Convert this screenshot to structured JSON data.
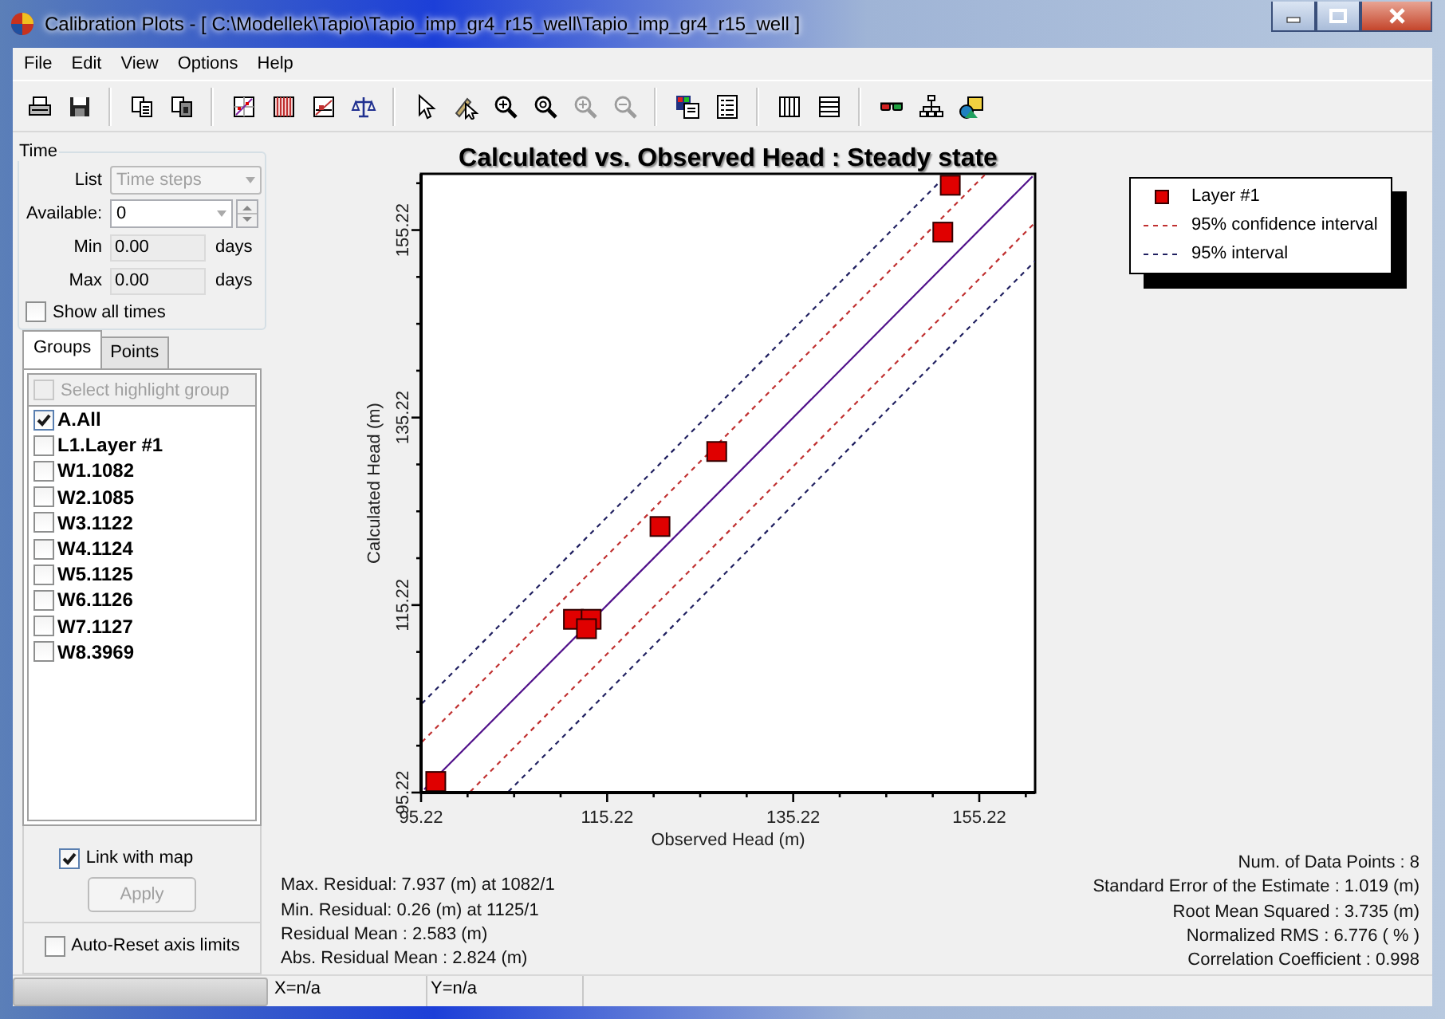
{
  "window": {
    "title": "Calibration Plots -  [ C:\\Modellek\\Tapio\\Tapio_imp_gr4_r15_well\\Tapio_imp_gr4_r15_well ]"
  },
  "menu": [
    "File",
    "Edit",
    "View",
    "Options",
    "Help"
  ],
  "toolbar": {
    "groups": [
      {
        "items": [
          {
            "kind": "print",
            "disabled": false
          },
          {
            "kind": "save",
            "disabled": false
          }
        ]
      },
      {
        "items": [
          {
            "kind": "copy",
            "disabled": false
          },
          {
            "kind": "copy-special",
            "disabled": false
          }
        ]
      },
      {
        "items": [
          {
            "kind": "chart-grid",
            "disabled": false
          },
          {
            "kind": "chart-hatch",
            "disabled": false
          },
          {
            "kind": "chart-fit",
            "disabled": false
          },
          {
            "kind": "balance",
            "disabled": false
          }
        ]
      },
      {
        "items": [
          {
            "kind": "pointer",
            "disabled": false
          },
          {
            "kind": "pointer-edit",
            "disabled": false
          },
          {
            "kind": "zoom-in",
            "disabled": false
          },
          {
            "kind": "zoom",
            "disabled": false
          },
          {
            "kind": "zoom-in",
            "disabled": true
          },
          {
            "kind": "zoom-out",
            "disabled": true
          }
        ]
      },
      {
        "items": [
          {
            "kind": "palette",
            "disabled": false
          },
          {
            "kind": "list",
            "disabled": false
          }
        ]
      },
      {
        "items": [
          {
            "kind": "columns",
            "disabled": false
          },
          {
            "kind": "rows",
            "disabled": false
          }
        ]
      },
      {
        "items": [
          {
            "kind": "glasses",
            "disabled": false
          },
          {
            "kind": "tree",
            "disabled": false
          },
          {
            "kind": "shapes",
            "disabled": false
          }
        ]
      }
    ]
  },
  "time_panel": {
    "title": "Time",
    "list": {
      "label": "List",
      "value": "Time steps",
      "disabled": true
    },
    "available": {
      "label": "Available:",
      "value": "0"
    },
    "min": {
      "label": "Min",
      "value": "0.00",
      "unit": "days"
    },
    "max": {
      "label": "Max",
      "value": "0.00",
      "unit": "days"
    },
    "show_all_times": {
      "label": "Show all times",
      "checked": false
    }
  },
  "tabs": [
    {
      "label": "Groups",
      "selected": true
    },
    {
      "label": "Points",
      "selected": false
    }
  ],
  "groups": {
    "select_all": {
      "label": "Select highlight group",
      "checked": false,
      "disabled": true
    },
    "items": [
      {
        "label": "A.All",
        "checked": true
      },
      {
        "label": "L1.Layer #1",
        "checked": false
      },
      {
        "label": "W1.1082",
        "checked": false
      },
      {
        "label": "W2.1085",
        "checked": false
      },
      {
        "label": "W3.1122",
        "checked": false
      },
      {
        "label": "W4.1124",
        "checked": false
      },
      {
        "label": "W5.1125",
        "checked": false
      },
      {
        "label": "W6.1126",
        "checked": false
      },
      {
        "label": "W7.1127",
        "checked": false
      },
      {
        "label": "W8.3969",
        "checked": false
      }
    ]
  },
  "link_with_map": {
    "label": "Link with map",
    "checked": true
  },
  "apply_button": {
    "label": "Apply",
    "disabled": true
  },
  "auto_reset": {
    "label": "Auto-Reset axis limits",
    "checked": false
  },
  "main": {
    "chart_data": {
      "type": "scatter",
      "title": "Calculated vs. Observed Head : Steady state",
      "xlabel": "Observed Head (m)",
      "ylabel": "Calculated Head (m)",
      "xlim": [
        95.22,
        161.22
      ],
      "ylim": [
        95.22,
        161.22
      ],
      "xticks": [
        95.22,
        115.22,
        135.22,
        155.22
      ],
      "yticks": [
        95.22,
        115.22,
        135.22,
        155.22
      ],
      "series": [
        {
          "name": "Layer #1",
          "color": "#e00000",
          "x": [
            96.8,
            111.6,
            113.5,
            113.0,
            120.9,
            127.0,
            151.3,
            152.1
          ],
          "values": [
            96.4,
            113.7,
            113.7,
            112.7,
            123.6,
            131.6,
            155.0,
            160.0
          ]
        },
        {
          "type": "line",
          "line_style": "solid",
          "color": "#50108a",
          "x": [
            95.3,
            161.2
          ],
          "values": [
            95.3,
            161.2
          ]
        },
        {
          "name": "95% confidence interval",
          "type": "line",
          "line_style": "dashed",
          "color": "#c03030",
          "x": [
            95.3,
            155.9
          ],
          "values": [
            100.6,
            161.2
          ]
        },
        {
          "type": "line",
          "line_style": "dashed",
          "color": "#c03030",
          "x": [
            100.5,
            161.2
          ],
          "values": [
            95.3,
            156.0
          ]
        },
        {
          "name": "95% interval",
          "type": "line",
          "line_style": "dashed",
          "color": "#202060",
          "x": [
            95.3,
            151.8
          ],
          "values": [
            104.7,
            161.2
          ]
        },
        {
          "type": "line",
          "line_style": "dashed",
          "color": "#202060",
          "x": [
            104.6,
            161.2
          ],
          "values": [
            95.3,
            151.9
          ]
        }
      ]
    }
  },
  "stats_left": [
    "Max. Residual: 7.937 (m) at 1082/1",
    "Min. Residual: 0.26 (m) at 1125/1",
    "Residual Mean : 2.583 (m)",
    "Abs. Residual Mean : 2.824 (m)"
  ],
  "stats_right": [
    "Num. of Data Points : 8",
    "Standard Error of the Estimate : 1.019 (m)",
    "Root Mean Squared : 3.735 (m)",
    "Normalized RMS : 6.776 ( % )",
    "Correlation Coefficient : 0.998"
  ],
  "status_bar": {
    "coords": [
      "X=n/a",
      "Y=n/a"
    ]
  }
}
